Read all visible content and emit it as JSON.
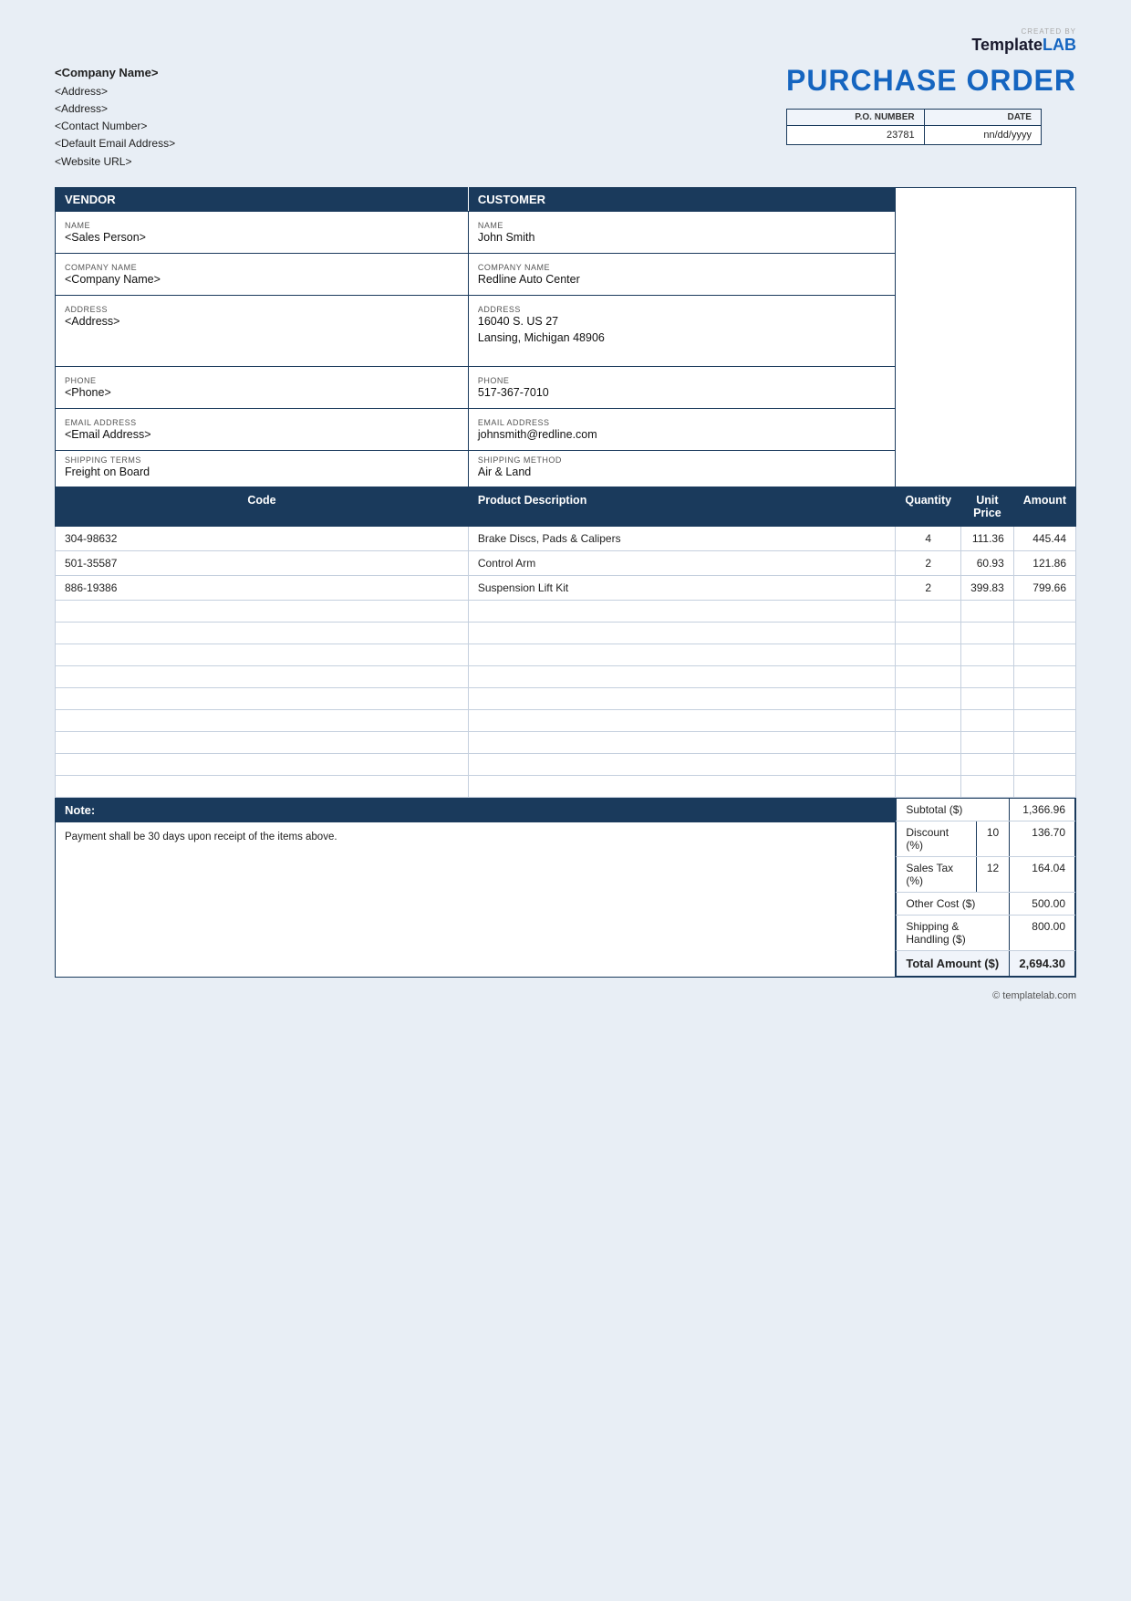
{
  "watermark": {
    "created_by": "CREATED BY",
    "brand_template": "Template",
    "brand_lab": "LAB"
  },
  "company": {
    "name": "<Company Name>",
    "address1": "<Address>",
    "address2": "<Address>",
    "contact": "<Contact Number>",
    "email": "<Default Email Address>",
    "website": "<Website URL>"
  },
  "po": {
    "title": "PURCHASE ORDER",
    "po_number_label": "P.O. NUMBER",
    "date_label": "DATE",
    "po_number": "23781",
    "date": "nn/dd/yyyy"
  },
  "vendor": {
    "section_label": "VENDOR",
    "name_label": "NAME",
    "name_value": "<Sales Person>",
    "company_label": "COMPANY NAME",
    "company_value": "<Company Name>",
    "address_label": "ADDRESS",
    "address_value": "<Address>",
    "phone_label": "PHONE",
    "phone_value": "<Phone>",
    "email_label": "EMAIL ADDRESS",
    "email_value": "<Email Address>"
  },
  "customer": {
    "section_label": "CUSTOMER",
    "name_label": "NAME",
    "name_value": "John Smith",
    "company_label": "COMPANY NAME",
    "company_value": "Redline Auto Center",
    "address_label": "ADDRESS",
    "address_value": "16040 S. US 27\nLansing, Michigan 48906",
    "address_line1": "16040 S. US 27",
    "address_line2": "Lansing, Michigan 48906",
    "phone_label": "PHONE",
    "phone_value": "517-367-7010",
    "email_label": "EMAIL ADDRESS",
    "email_value": "johnsmith@redline.com"
  },
  "shipping": {
    "terms_label": "SHIPPING TERMS",
    "terms_value": "Freight on Board",
    "method_label": "SHIPPING METHOD",
    "method_value": "Air & Land"
  },
  "items_table": {
    "col_code": "Code",
    "col_description": "Product Description",
    "col_quantity": "Quantity",
    "col_unit_price": "Unit Price",
    "col_amount": "Amount",
    "rows": [
      {
        "code": "304-98632",
        "description": "Brake Discs, Pads & Calipers",
        "quantity": "4",
        "unit_price": "111.36",
        "amount": "445.44"
      },
      {
        "code": "501-35587",
        "description": "Control Arm",
        "quantity": "2",
        "unit_price": "60.93",
        "amount": "121.86"
      },
      {
        "code": "886-19386",
        "description": "Suspension Lift Kit",
        "quantity": "2",
        "unit_price": "399.83",
        "amount": "799.66"
      },
      {
        "code": "",
        "description": "",
        "quantity": "",
        "unit_price": "",
        "amount": ""
      },
      {
        "code": "",
        "description": "",
        "quantity": "",
        "unit_price": "",
        "amount": ""
      },
      {
        "code": "",
        "description": "",
        "quantity": "",
        "unit_price": "",
        "amount": ""
      },
      {
        "code": "",
        "description": "",
        "quantity": "",
        "unit_price": "",
        "amount": ""
      },
      {
        "code": "",
        "description": "",
        "quantity": "",
        "unit_price": "",
        "amount": ""
      },
      {
        "code": "",
        "description": "",
        "quantity": "",
        "unit_price": "",
        "amount": ""
      },
      {
        "code": "",
        "description": "",
        "quantity": "",
        "unit_price": "",
        "amount": ""
      },
      {
        "code": "",
        "description": "",
        "quantity": "",
        "unit_price": "",
        "amount": ""
      },
      {
        "code": "",
        "description": "",
        "quantity": "",
        "unit_price": "",
        "amount": ""
      }
    ]
  },
  "note": {
    "label": "Note:",
    "text": "Payment shall be 30 days upon receipt of the items above."
  },
  "summary": {
    "subtotal_label": "Subtotal ($)",
    "subtotal_value": "1,366.96",
    "discount_label": "Discount (%)",
    "discount_pct": "10",
    "discount_value": "136.70",
    "tax_label": "Sales Tax (%)",
    "tax_pct": "12",
    "tax_value": "164.04",
    "other_label": "Other Cost ($)",
    "other_value": "500.00",
    "shipping_label": "Shipping & Handling ($)",
    "shipping_value": "800.00",
    "total_label": "Total Amount ($)",
    "total_value": "2,694.30"
  },
  "footer": {
    "credit": "© templatelab.com"
  }
}
